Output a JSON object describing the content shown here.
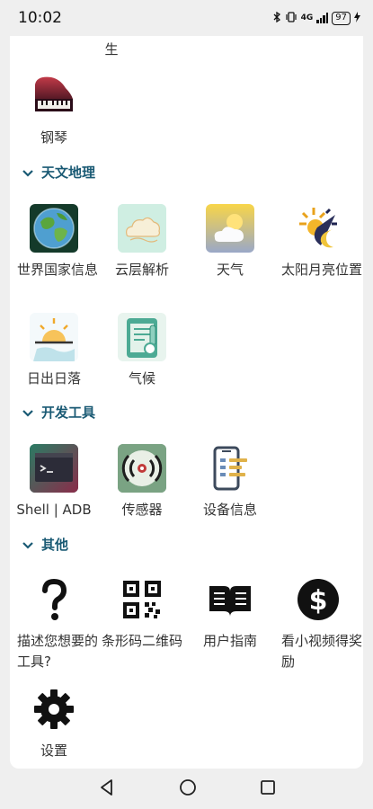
{
  "status": {
    "time": "10:02",
    "network": "4G",
    "battery": "97"
  },
  "top_cutoff_label": "生",
  "piano": {
    "label": "钢琴"
  },
  "sections": {
    "astronomy": {
      "title": "天文地理",
      "items": [
        {
          "label": "世界国家信息",
          "icon": "globe-icon"
        },
        {
          "label": "云层解析",
          "icon": "cloud-icon"
        },
        {
          "label": "天气",
          "icon": "weather-icon"
        },
        {
          "label": "太阳月亮位置",
          "icon": "sun-moon-icon"
        },
        {
          "label": "日出日落",
          "icon": "sunrise-icon"
        },
        {
          "label": "气候",
          "icon": "climate-icon"
        }
      ]
    },
    "dev": {
      "title": "开发工具",
      "items": [
        {
          "label": "Shell | ADB",
          "icon": "terminal-icon"
        },
        {
          "label": "传感器",
          "icon": "sensor-icon"
        },
        {
          "label": "设备信息",
          "icon": "device-info-icon"
        }
      ]
    },
    "other": {
      "title": "其他",
      "items": [
        {
          "label": "描述您想要的工具?",
          "icon": "question-icon"
        },
        {
          "label": "条形码二维码",
          "icon": "qr-code-icon"
        },
        {
          "label": "用户指南",
          "icon": "book-icon"
        },
        {
          "label": "看小视频得奖励",
          "icon": "dollar-icon"
        },
        {
          "label": "设置",
          "icon": "gear-icon"
        }
      ]
    }
  },
  "navbar": {
    "back": "back-icon",
    "home": "home-icon",
    "recents": "recents-icon"
  }
}
